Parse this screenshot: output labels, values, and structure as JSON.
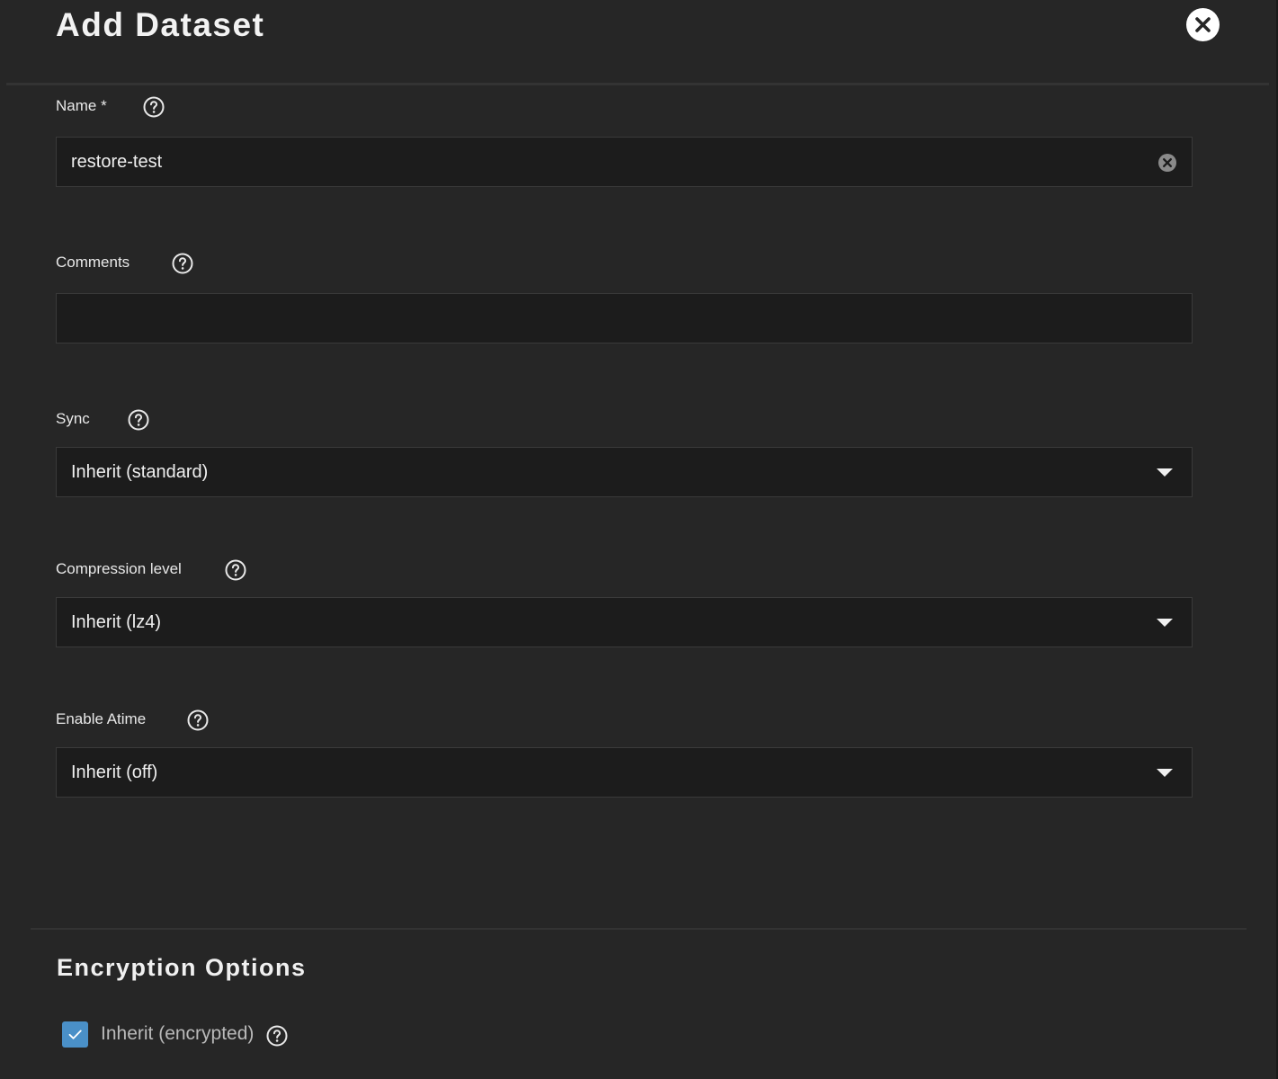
{
  "dialog": {
    "title": "Add Dataset"
  },
  "fields": {
    "name": {
      "label": "Name *",
      "value": "restore-test"
    },
    "comments": {
      "label": "Comments",
      "value": ""
    },
    "sync": {
      "label": "Sync",
      "selected": "Inherit (standard)"
    },
    "compression": {
      "label": "Compression level",
      "selected": "Inherit (lz4)"
    },
    "atime": {
      "label": "Enable Atime",
      "selected": "Inherit (off)"
    }
  },
  "encryption": {
    "title": "Encryption Options",
    "inherit_label": "Inherit (encrypted)",
    "inherit_checked": true
  },
  "icons": {
    "close": "close-icon",
    "help": "help-icon",
    "clear": "clear-icon",
    "dropdown": "chevron-down-icon",
    "check": "check-icon"
  },
  "colors": {
    "background": "#262626",
    "field_background": "#1c1c1c",
    "checkbox_accent": "#4a90c8"
  }
}
